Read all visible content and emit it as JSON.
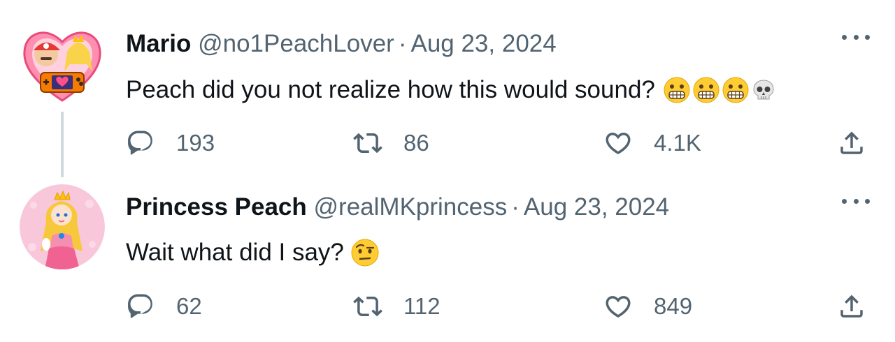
{
  "tweets": [
    {
      "name": "Mario",
      "handle": "@no1PeachLover",
      "separator": "·",
      "date": "Aug 23, 2024",
      "text": "Peach did you not realize how this would sound?",
      "emojis": [
        "grimacing-face",
        "grimacing-face",
        "grimacing-face",
        "skull"
      ],
      "replies": "193",
      "retweets": "86",
      "likes": "4.1K"
    },
    {
      "name": "Princess Peach",
      "handle": "@realMKprincess",
      "separator": "·",
      "date": "Aug 23, 2024",
      "text": "Wait what did I say?",
      "emojis": [
        "face-with-raised-eyebrow"
      ],
      "replies": "62",
      "retweets": "112",
      "likes": "849"
    }
  ],
  "colors": {
    "text_primary": "#0f1419",
    "text_secondary": "#536471",
    "thread_line": "#cfd9de",
    "emoji_yellow": "#ffcc33"
  }
}
